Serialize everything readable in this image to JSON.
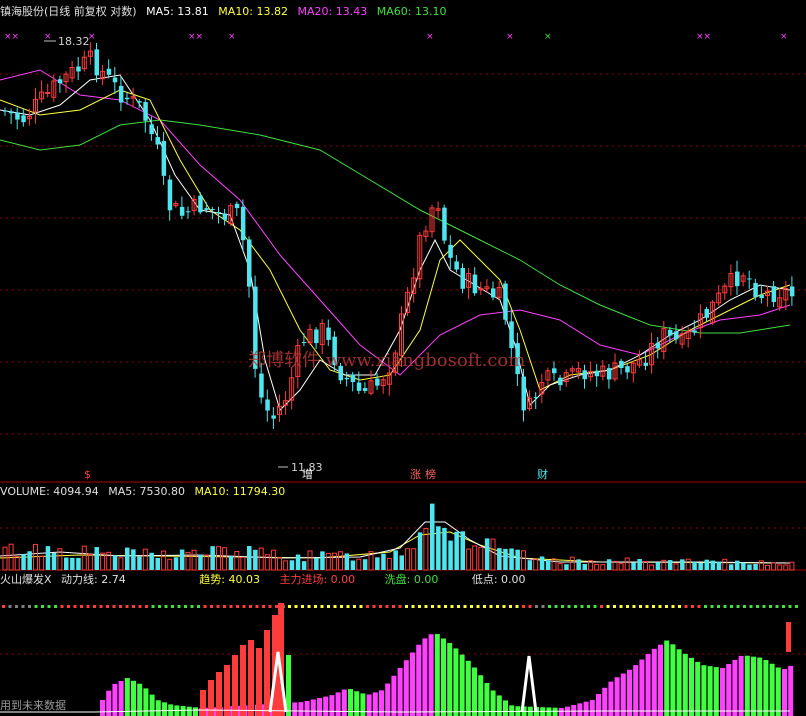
{
  "colors": {
    "up": "#ff3c3c",
    "down": "#4ee6ee",
    "ma5": "#ffffff",
    "ma10": "#ffff40",
    "ma20": "#ff40ff",
    "ma60": "#40e040",
    "grid": "#8a0000"
  },
  "header": {
    "title": "镇海股份(日线 前复权 对数)",
    "ma5": "MA5: 13.81",
    "ma10": "MA10: 13.82",
    "ma20": "MA20: 13.43",
    "ma60": "MA60: 13.10"
  },
  "price_chart": {
    "high_label": "18.32",
    "low_label": "11.83",
    "markers": [
      "$",
      "增",
      "涨",
      "榜",
      "财"
    ]
  },
  "volume": {
    "label": "VOLUME: 4094.94",
    "ma5": "MA5: 7530.80",
    "ma10": "MA10: 11794.30"
  },
  "indicator": {
    "name": "火山爆发X",
    "power": "动力线: 2.74",
    "trend": "趋势: 40.03",
    "main_force": "主力进场: 0.00",
    "wash": "洗盘: 0.00",
    "low": "低点: 0.00"
  },
  "watermark": "郑博软件 www.xiangbosoft.com",
  "footer": "用到未来数据",
  "chart_data": {
    "type": "candlestick",
    "series": [
      {
        "name": "MA5",
        "value": 13.81
      },
      {
        "name": "MA10",
        "value": 13.82
      },
      {
        "name": "MA20",
        "value": 13.43
      },
      {
        "name": "MA60",
        "value": 13.1
      }
    ],
    "annotations": [
      {
        "text": "18.32",
        "kind": "high"
      },
      {
        "text": "11.83",
        "kind": "low"
      }
    ]
  }
}
